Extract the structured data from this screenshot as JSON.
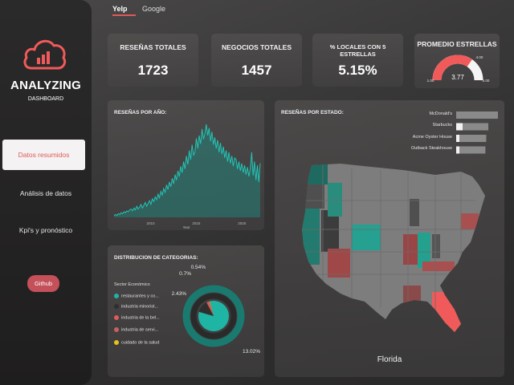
{
  "brand": {
    "name": "ANALYZING",
    "subtitle": "DASHBOARD"
  },
  "sidebar": {
    "items": [
      {
        "label": "Datos resumidos",
        "active": true
      },
      {
        "label": "Análisis de datos",
        "active": false
      },
      {
        "label": "Kpi's y pronóstico",
        "active": false
      }
    ],
    "github_label": "Github"
  },
  "tabs": [
    {
      "label": "Yelp",
      "active": true
    },
    {
      "label": "Google",
      "active": false
    }
  ],
  "kpis": [
    {
      "label": "RESEÑAS TOTALES",
      "value": "1723"
    },
    {
      "label": "NEGOCIOS TOTALES",
      "value": "1457"
    },
    {
      "label": "% LOCALES CON 5 ESTRELLAS",
      "value": "5.15%"
    }
  ],
  "rating": {
    "title": "PROMEDIO ESTRELLAS",
    "value": 3.77,
    "value_label": "3.77",
    "min_label": "1.00",
    "max_label": "5.00",
    "target_label": "4.00",
    "colors": {
      "fill": "#f05a5a",
      "track": "#f5f5f5"
    }
  },
  "reviews_chart": {
    "title": "RESEÑAS POR AÑO:",
    "chart_data": {
      "type": "area",
      "title": "RESEÑAS POR AÑO:",
      "xlabel": "Year",
      "ylabel": "",
      "xlim": [
        2006,
        2022
      ],
      "x_ticks": [
        "2010",
        "2015",
        "2020"
      ],
      "series": [
        {
          "values": [
            2,
            3,
            2,
            4,
            3,
            5,
            4,
            6,
            5,
            7,
            6,
            8,
            9,
            7,
            10,
            8,
            12,
            9,
            11,
            14,
            10,
            13,
            16,
            12,
            15,
            18,
            14,
            20,
            17,
            22,
            19,
            25,
            21,
            28,
            24,
            31,
            27,
            35,
            30,
            38,
            33,
            42,
            36,
            46,
            40,
            50,
            44,
            55,
            48,
            60,
            52,
            66,
            57,
            72,
            62,
            78,
            67,
            70,
            85,
            74,
            88,
            79,
            95,
            84,
            90,
            100,
            88,
            96,
            82,
            92,
            78,
            86,
            74,
            83,
            70,
            80,
            68,
            76,
            64,
            72,
            60,
            70,
            58,
            66,
            55,
            64,
            62,
            52,
            60,
            50,
            58,
            48,
            56,
            46,
            54,
            44,
            52,
            70,
            45,
            60,
            40,
            56,
            38,
            58
          ]
        }
      ],
      "colors": {
        "line": "#22c4b4"
      }
    }
  },
  "categories": {
    "title": "DISTRIBUCION DE CATEGORIAS:",
    "legend_title": "Sector Económico",
    "chart_data": {
      "type": "pie",
      "labels": [
        "restaurantes y co...",
        "industria minorist...",
        "industria de la bel...",
        "industria de servi...",
        "cuidado de la salud"
      ],
      "values": [
        83.91,
        13.02,
        2.43,
        0.7,
        0.54
      ],
      "colors": [
        "#1fb5a4",
        "#2f2f2f",
        "#e25a5a",
        "#c96060",
        "#e3c21b"
      ],
      "percent_labels": [
        "13.02%",
        "2.43%",
        "0.7%",
        "0.54%"
      ]
    }
  },
  "state_map": {
    "title": "RESEÑAS POR ESTADO:",
    "selected_state": "Florida",
    "chart_data": {
      "type": "bar",
      "categories": [
        "McDonald's",
        "Starbucks",
        "Acme Oyster House",
        "Outback Steakhouse"
      ],
      "values": [
        100,
        77,
        72,
        70
      ],
      "highlight": [
        0,
        8,
        4,
        4
      ]
    }
  }
}
